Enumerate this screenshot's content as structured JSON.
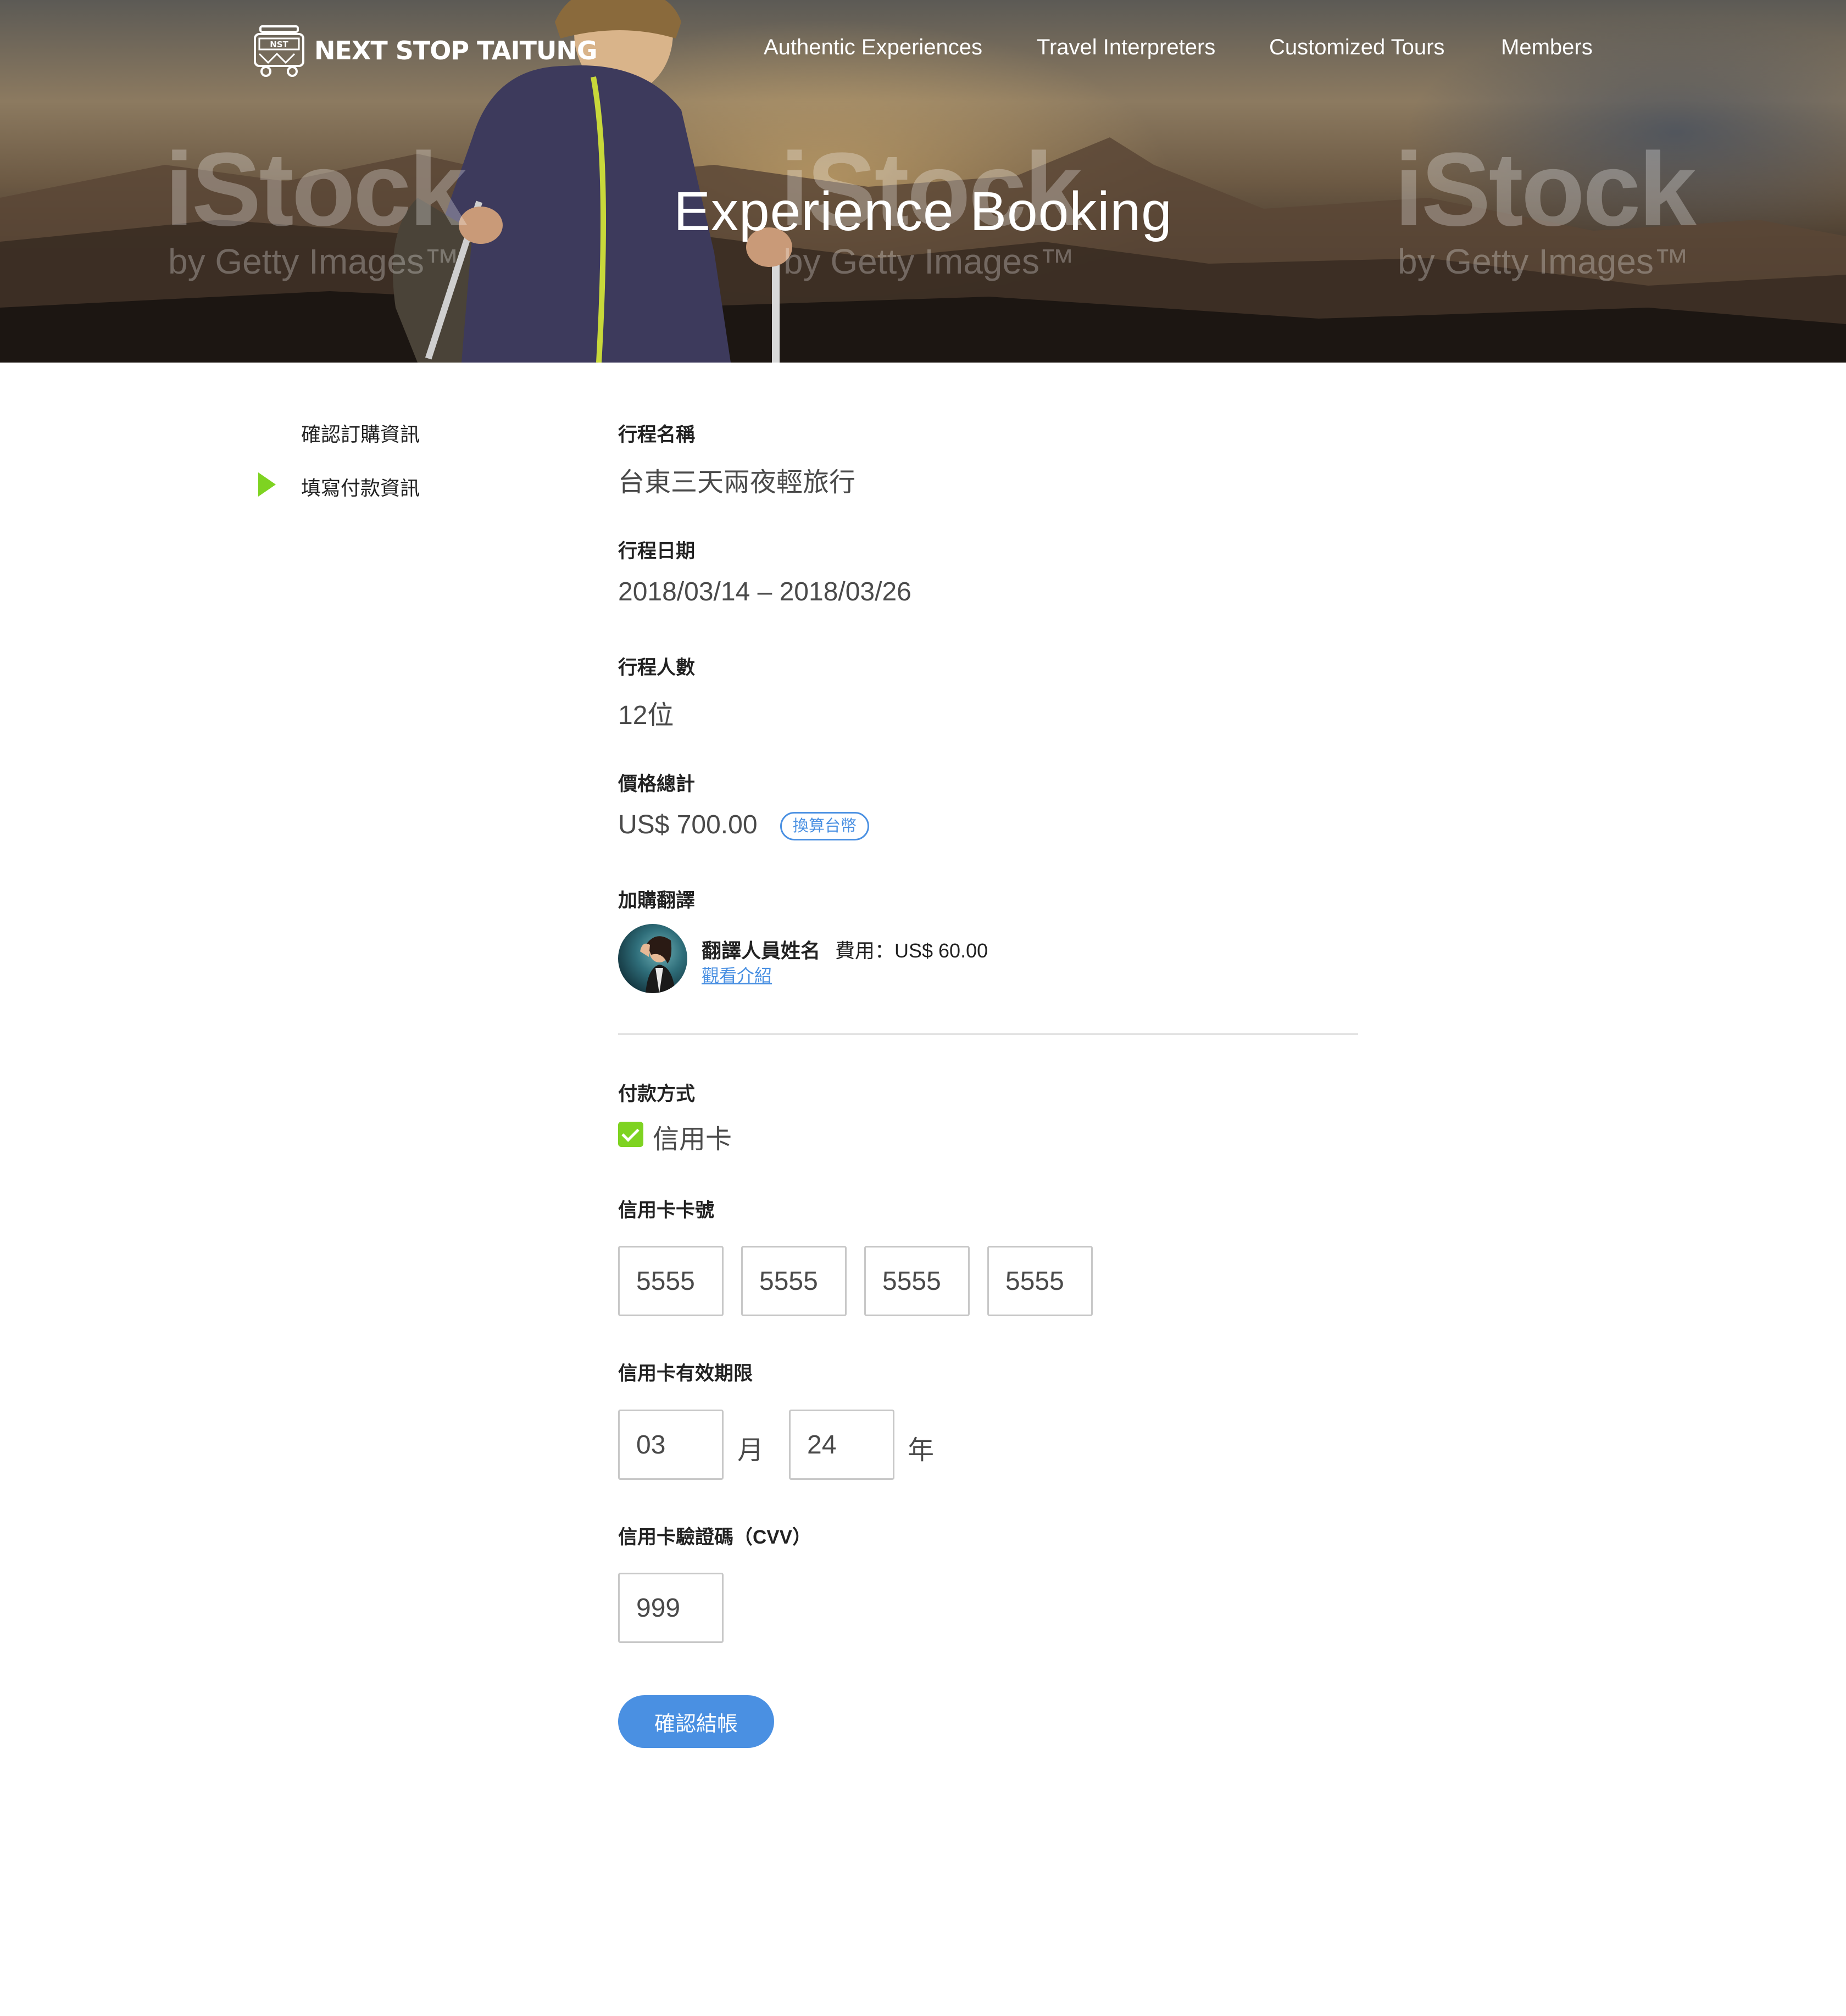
{
  "header": {
    "logo_text": "NEXT STOP TAITUNG",
    "nav": [
      {
        "label": "Authentic Experiences"
      },
      {
        "label": "Travel Interpreters"
      },
      {
        "label": "Customized Tours"
      },
      {
        "label": "Members"
      }
    ],
    "hero_title": "Experience Booking",
    "watermark": {
      "brand": "iStock",
      "tagline": "by Getty Images™"
    }
  },
  "sidebar": {
    "steps": [
      {
        "label": "確認訂購資訊",
        "active": false
      },
      {
        "label": "填寫付款資訊",
        "active": true
      }
    ]
  },
  "booking": {
    "trip_name_label": "行程名稱",
    "trip_name": "台東三天兩夜輕旅行",
    "trip_dates_label": "行程日期",
    "trip_dates": "2018/03/14 – 2018/03/26",
    "people_label": "行程人數",
    "people": "12位",
    "total_label": "價格總計",
    "total": "US$ 700.00",
    "convert_label": "換算台幣",
    "interpreter_label": "加購翻譯",
    "interpreter_name": "翻譯人員姓名",
    "interpreter_fee": "費用：US$ 60.00",
    "interpreter_link": "觀看介紹"
  },
  "payment": {
    "method_label": "付款方式",
    "method": "信用卡",
    "method_checked": true,
    "card_number_label": "信用卡卡號",
    "card_number": [
      "5555",
      "5555",
      "5555",
      "5555"
    ],
    "expiry_label": "信用卡有效期限",
    "expiry_month": "03",
    "month_unit": "月",
    "expiry_year": "24",
    "year_unit": "年",
    "cvv_label": "信用卡驗證碼（CVV）",
    "cvv": "999",
    "submit_label": "確認結帳"
  },
  "colors": {
    "accent_blue": "#4a90e2",
    "accent_green": "#7ed321",
    "text_dark": "#222222",
    "text_value": "#4a4a4a",
    "field_border": "#c8c8c8"
  }
}
